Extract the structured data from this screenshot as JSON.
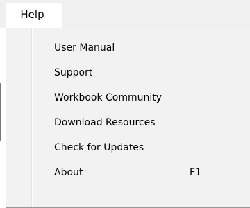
{
  "menubar": {
    "active_menu": "Help"
  },
  "help_menu": {
    "items": [
      {
        "label": "User Manual",
        "shortcut": ""
      },
      {
        "label": "Support",
        "shortcut": ""
      },
      {
        "label": "Workbook Community",
        "shortcut": ""
      },
      {
        "label": "Download Resources",
        "shortcut": ""
      },
      {
        "label": "Check for Updates",
        "shortcut": ""
      },
      {
        "label": "About",
        "shortcut": "F1"
      }
    ]
  },
  "colors": {
    "menu_background": "#f2f2f2",
    "menu_border": "#979797",
    "menubar_background": "#f0f0f0",
    "text": "#000000"
  }
}
